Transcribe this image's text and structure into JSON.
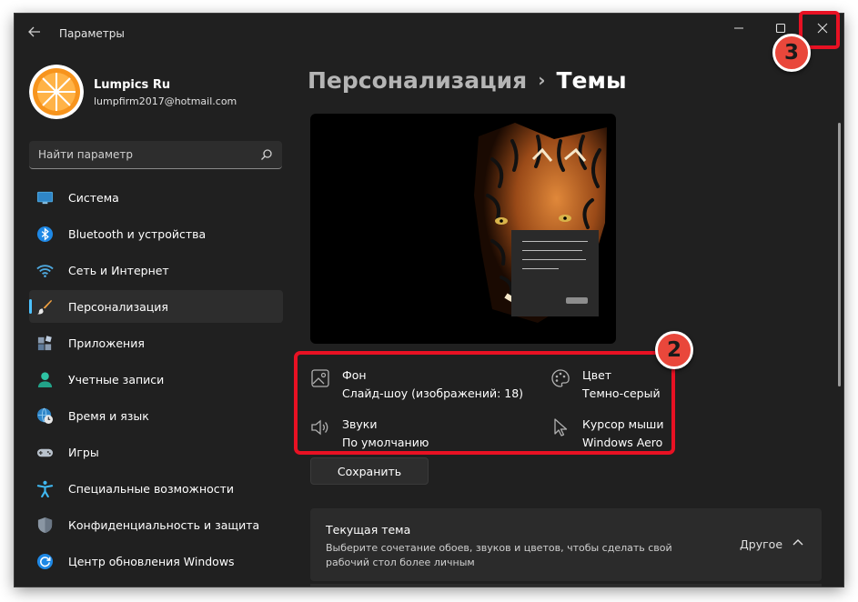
{
  "window": {
    "title": "Параметры"
  },
  "profile": {
    "name": "Lumpics Ru",
    "email": "lumpfirm2017@hotmail.com"
  },
  "search": {
    "placeholder": "Найти параметр",
    "icon": "search-icon"
  },
  "sidebar": {
    "items": [
      {
        "label": "Система",
        "icon": "monitor-icon"
      },
      {
        "label": "Bluetooth и устройства",
        "icon": "bluetooth-icon"
      },
      {
        "label": "Сеть и Интернет",
        "icon": "wifi-icon"
      },
      {
        "label": "Персонализация",
        "icon": "brush-icon",
        "active": true
      },
      {
        "label": "Приложения",
        "icon": "apps-icon"
      },
      {
        "label": "Учетные записи",
        "icon": "person-icon"
      },
      {
        "label": "Время и язык",
        "icon": "globe-clock-icon"
      },
      {
        "label": "Игры",
        "icon": "gamepad-icon"
      },
      {
        "label": "Специальные возможности",
        "icon": "accessibility-icon"
      },
      {
        "label": "Конфиденциальность и защита",
        "icon": "shield-icon"
      },
      {
        "label": "Центр обновления Windows",
        "icon": "update-icon"
      }
    ]
  },
  "header": {
    "parent": "Персонализация",
    "separator": "›",
    "current": "Темы"
  },
  "theme_props": {
    "background": {
      "title": "Фон",
      "value": "Слайд-шоу (изображений: 18)"
    },
    "color": {
      "title": "Цвет",
      "value": "Темно-серый"
    },
    "sounds": {
      "title": "Звуки",
      "value": "По умолчанию"
    },
    "cursor": {
      "title": "Курсор мыши",
      "value": "Windows Aero"
    }
  },
  "save_label": "Сохранить",
  "current_theme": {
    "title": "Текущая тема",
    "description": "Выберите сочетание обоев, звуков и цветов, чтобы сделать свой рабочий стол более личным",
    "value": "Другое"
  },
  "annotations": {
    "step2": "2",
    "step3": "3"
  },
  "colors": {
    "accent": "#4cc2ff",
    "highlight": "#e81123",
    "badge": "#e9473b",
    "window_bg": "#202020"
  }
}
